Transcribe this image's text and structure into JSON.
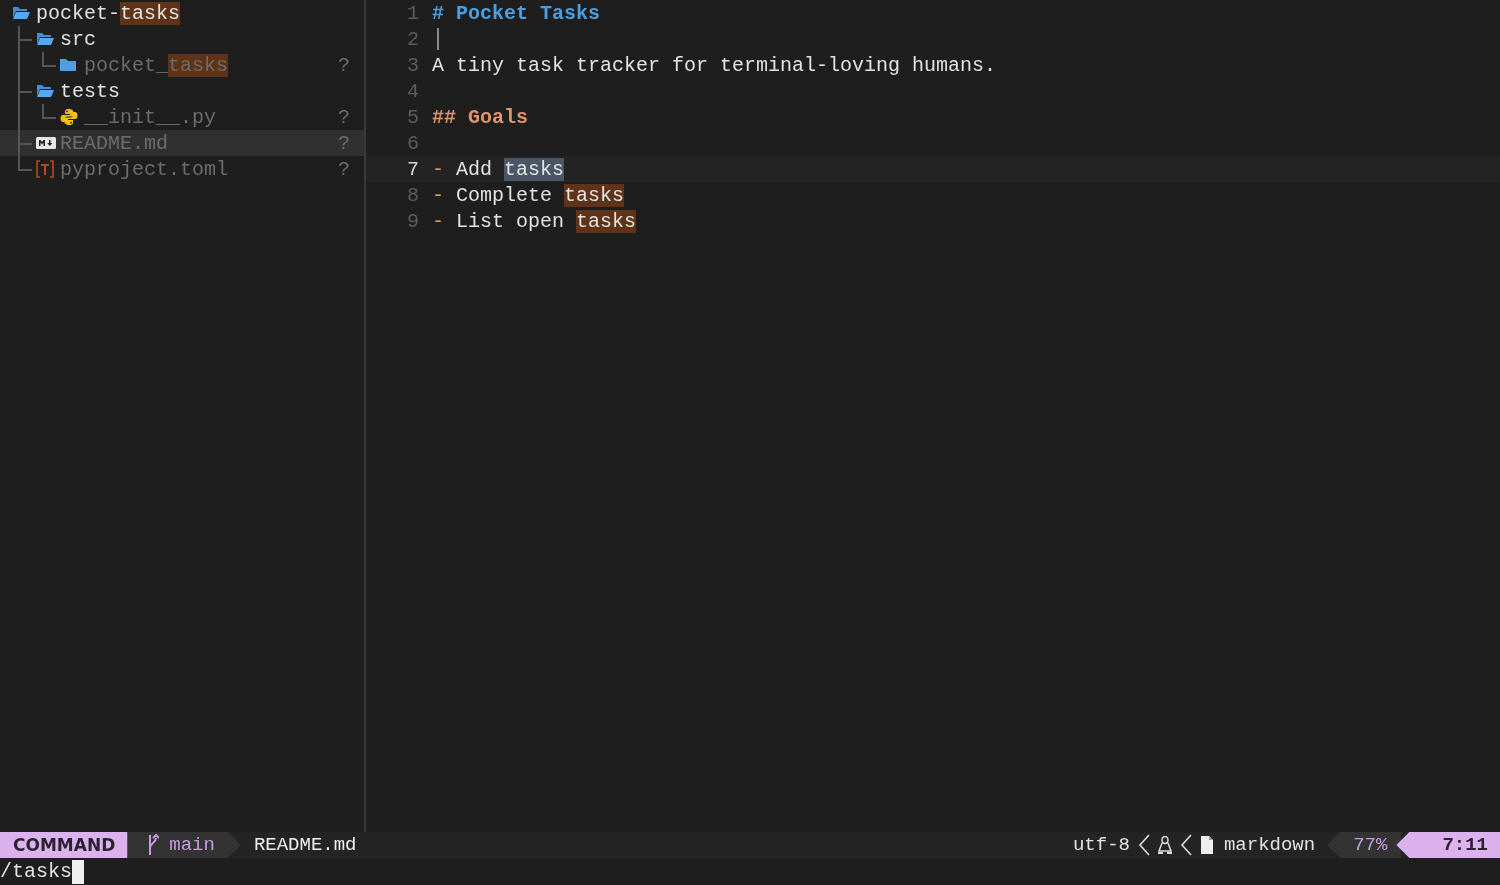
{
  "tree": {
    "kind": "folder-open",
    "parts": [
      {
        "text": "pocket-",
        "match": false
      },
      {
        "text": "tasks",
        "match": true
      }
    ],
    "dimmed": false,
    "selected": false,
    "children": [
      {
        "kind": "folder-open",
        "parts": [
          {
            "text": "src",
            "match": false
          }
        ],
        "dimmed": false,
        "selected": false,
        "children": [
          {
            "kind": "folder",
            "parts": [
              {
                "text": "pocket_",
                "match": false
              },
              {
                "text": "tasks",
                "match": true
              }
            ],
            "dimmed": true,
            "selected": false,
            "status": "?"
          }
        ]
      },
      {
        "kind": "folder-open",
        "parts": [
          {
            "text": "tests",
            "match": false
          }
        ],
        "dimmed": false,
        "selected": false,
        "children": [
          {
            "kind": "python",
            "parts": [
              {
                "text": "__init__.py",
                "match": false
              }
            ],
            "dimmed": true,
            "selected": false,
            "status": "?"
          }
        ]
      },
      {
        "kind": "markdown",
        "parts": [
          {
            "text": "README.md",
            "match": false
          }
        ],
        "dimmed": true,
        "selected": true,
        "status": "?"
      },
      {
        "kind": "toml",
        "parts": [
          {
            "text": "pyproject.toml",
            "match": false
          }
        ],
        "dimmed": true,
        "selected": false,
        "status": "?"
      }
    ]
  },
  "editor": {
    "lines": [
      {
        "number": "1",
        "kind": "h1",
        "text": "# Pocket Tasks",
        "active": false,
        "cursor": false
      },
      {
        "number": "2",
        "kind": "empty",
        "active": false,
        "cursor": true
      },
      {
        "number": "3",
        "kind": "text",
        "text": "A tiny task tracker for terminal-loving humans.",
        "active": false,
        "cursor": false
      },
      {
        "number": "4",
        "kind": "empty",
        "active": false,
        "cursor": false
      },
      {
        "number": "5",
        "kind": "h2",
        "text": "## Goals",
        "active": false,
        "cursor": false
      },
      {
        "number": "6",
        "kind": "empty",
        "active": false,
        "cursor": false
      },
      {
        "number": "7",
        "kind": "list",
        "marker": "-",
        "parts": [
          {
            "text": "Add ",
            "match": false
          },
          {
            "text": "tasks",
            "match": true,
            "current": true
          }
        ],
        "active": true,
        "cursor": false
      },
      {
        "number": "8",
        "kind": "list",
        "marker": "-",
        "parts": [
          {
            "text": "Complete ",
            "match": false
          },
          {
            "text": "tasks",
            "match": true,
            "current": false
          }
        ],
        "active": false,
        "cursor": false
      },
      {
        "number": "9",
        "kind": "list",
        "marker": "-",
        "parts": [
          {
            "text": "List open ",
            "match": false
          },
          {
            "text": "tasks",
            "match": true,
            "current": false
          }
        ],
        "active": false,
        "cursor": false
      }
    ]
  },
  "status_bar": {
    "mode": "COMMAND",
    "branch": "main",
    "file": "README.md",
    "encoding": "utf-8",
    "filetype": "markdown",
    "progress": "77%",
    "position": "7:11"
  },
  "command_line": {
    "text": "/tasks"
  }
}
